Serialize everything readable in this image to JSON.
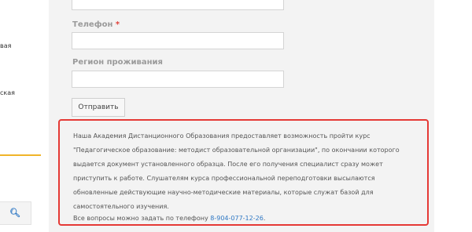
{
  "sidebar": {
    "fragment_1": "вая",
    "fragment_2": "ская",
    "search_icon": "search-icon"
  },
  "form": {
    "phone_label": "Телефон",
    "required_mark": "*",
    "region_label": "Регион проживания",
    "submit_label": "Отправить",
    "phone_value": "",
    "region_value": ""
  },
  "info": {
    "lines": [
      "Наша Академия Дистанционного Образования предоставляет возможность пройти курс",
      "\"Педагогическое образование: методист образовательной организации\", по окончании которого",
      "выдается документ установленного образца. После его получения специалист сразу может",
      "приступить к работе. Слушателям курса профессиональной переподготовки высылаются",
      "обновленные действующие научно-методические материалы, которые служат базой для",
      "самостоятельного изучения."
    ],
    "contact_prefix": "Все вопросы можно задать по телефону ",
    "phone": "8-904-077-12-26",
    "contact_suffix": "."
  },
  "colors": {
    "accent": "#2f78c4",
    "highlight_border": "#e53935",
    "required": "#e0403a",
    "divider": "#f0b429"
  }
}
